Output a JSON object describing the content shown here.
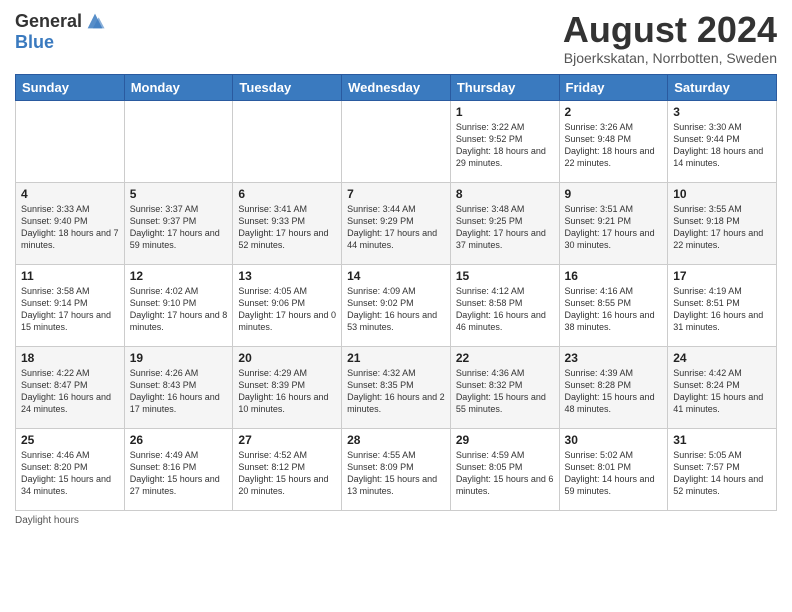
{
  "header": {
    "logo_general": "General",
    "logo_blue": "Blue",
    "title": "August 2024",
    "location": "Bjoerkskatan, Norrbotten, Sweden"
  },
  "days_of_week": [
    "Sunday",
    "Monday",
    "Tuesday",
    "Wednesday",
    "Thursday",
    "Friday",
    "Saturday"
  ],
  "weeks": [
    [
      {
        "day": "",
        "info": ""
      },
      {
        "day": "",
        "info": ""
      },
      {
        "day": "",
        "info": ""
      },
      {
        "day": "",
        "info": ""
      },
      {
        "day": "1",
        "info": "Sunrise: 3:22 AM\nSunset: 9:52 PM\nDaylight: 18 hours\nand 29 minutes."
      },
      {
        "day": "2",
        "info": "Sunrise: 3:26 AM\nSunset: 9:48 PM\nDaylight: 18 hours\nand 22 minutes."
      },
      {
        "day": "3",
        "info": "Sunrise: 3:30 AM\nSunset: 9:44 PM\nDaylight: 18 hours\nand 14 minutes."
      }
    ],
    [
      {
        "day": "4",
        "info": "Sunrise: 3:33 AM\nSunset: 9:40 PM\nDaylight: 18 hours\nand 7 minutes."
      },
      {
        "day": "5",
        "info": "Sunrise: 3:37 AM\nSunset: 9:37 PM\nDaylight: 17 hours\nand 59 minutes."
      },
      {
        "day": "6",
        "info": "Sunrise: 3:41 AM\nSunset: 9:33 PM\nDaylight: 17 hours\nand 52 minutes."
      },
      {
        "day": "7",
        "info": "Sunrise: 3:44 AM\nSunset: 9:29 PM\nDaylight: 17 hours\nand 44 minutes."
      },
      {
        "day": "8",
        "info": "Sunrise: 3:48 AM\nSunset: 9:25 PM\nDaylight: 17 hours\nand 37 minutes."
      },
      {
        "day": "9",
        "info": "Sunrise: 3:51 AM\nSunset: 9:21 PM\nDaylight: 17 hours\nand 30 minutes."
      },
      {
        "day": "10",
        "info": "Sunrise: 3:55 AM\nSunset: 9:18 PM\nDaylight: 17 hours\nand 22 minutes."
      }
    ],
    [
      {
        "day": "11",
        "info": "Sunrise: 3:58 AM\nSunset: 9:14 PM\nDaylight: 17 hours\nand 15 minutes."
      },
      {
        "day": "12",
        "info": "Sunrise: 4:02 AM\nSunset: 9:10 PM\nDaylight: 17 hours\nand 8 minutes."
      },
      {
        "day": "13",
        "info": "Sunrise: 4:05 AM\nSunset: 9:06 PM\nDaylight: 17 hours\nand 0 minutes."
      },
      {
        "day": "14",
        "info": "Sunrise: 4:09 AM\nSunset: 9:02 PM\nDaylight: 16 hours\nand 53 minutes."
      },
      {
        "day": "15",
        "info": "Sunrise: 4:12 AM\nSunset: 8:58 PM\nDaylight: 16 hours\nand 46 minutes."
      },
      {
        "day": "16",
        "info": "Sunrise: 4:16 AM\nSunset: 8:55 PM\nDaylight: 16 hours\nand 38 minutes."
      },
      {
        "day": "17",
        "info": "Sunrise: 4:19 AM\nSunset: 8:51 PM\nDaylight: 16 hours\nand 31 minutes."
      }
    ],
    [
      {
        "day": "18",
        "info": "Sunrise: 4:22 AM\nSunset: 8:47 PM\nDaylight: 16 hours\nand 24 minutes."
      },
      {
        "day": "19",
        "info": "Sunrise: 4:26 AM\nSunset: 8:43 PM\nDaylight: 16 hours\nand 17 minutes."
      },
      {
        "day": "20",
        "info": "Sunrise: 4:29 AM\nSunset: 8:39 PM\nDaylight: 16 hours\nand 10 minutes."
      },
      {
        "day": "21",
        "info": "Sunrise: 4:32 AM\nSunset: 8:35 PM\nDaylight: 16 hours\nand 2 minutes."
      },
      {
        "day": "22",
        "info": "Sunrise: 4:36 AM\nSunset: 8:32 PM\nDaylight: 15 hours\nand 55 minutes."
      },
      {
        "day": "23",
        "info": "Sunrise: 4:39 AM\nSunset: 8:28 PM\nDaylight: 15 hours\nand 48 minutes."
      },
      {
        "day": "24",
        "info": "Sunrise: 4:42 AM\nSunset: 8:24 PM\nDaylight: 15 hours\nand 41 minutes."
      }
    ],
    [
      {
        "day": "25",
        "info": "Sunrise: 4:46 AM\nSunset: 8:20 PM\nDaylight: 15 hours\nand 34 minutes."
      },
      {
        "day": "26",
        "info": "Sunrise: 4:49 AM\nSunset: 8:16 PM\nDaylight: 15 hours\nand 27 minutes."
      },
      {
        "day": "27",
        "info": "Sunrise: 4:52 AM\nSunset: 8:12 PM\nDaylight: 15 hours\nand 20 minutes."
      },
      {
        "day": "28",
        "info": "Sunrise: 4:55 AM\nSunset: 8:09 PM\nDaylight: 15 hours\nand 13 minutes."
      },
      {
        "day": "29",
        "info": "Sunrise: 4:59 AM\nSunset: 8:05 PM\nDaylight: 15 hours\nand 6 minutes."
      },
      {
        "day": "30",
        "info": "Sunrise: 5:02 AM\nSunset: 8:01 PM\nDaylight: 14 hours\nand 59 minutes."
      },
      {
        "day": "31",
        "info": "Sunrise: 5:05 AM\nSunset: 7:57 PM\nDaylight: 14 hours\nand 52 minutes."
      }
    ]
  ],
  "footer": {
    "daylight_label": "Daylight hours"
  }
}
